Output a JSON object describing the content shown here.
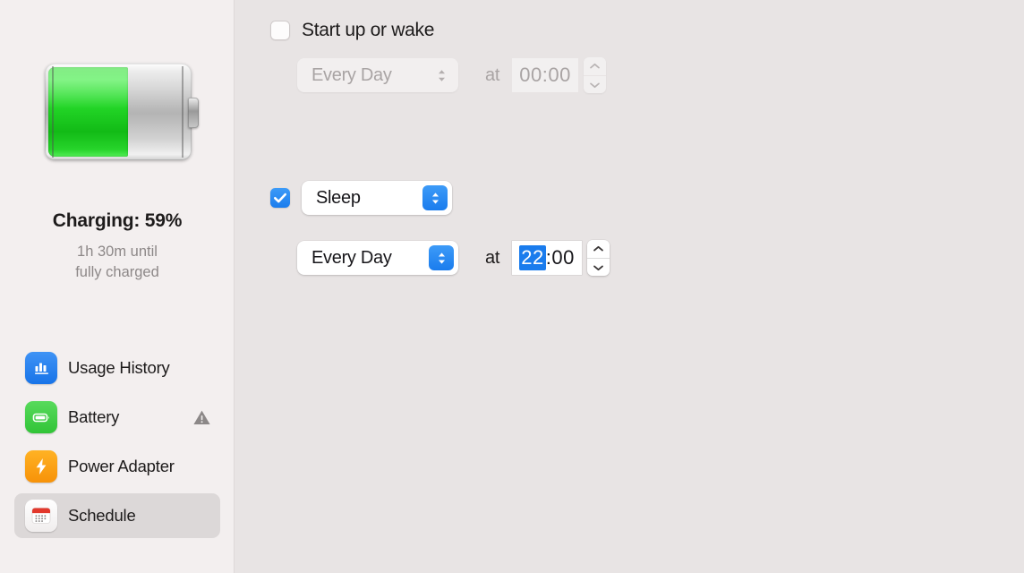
{
  "sidebar": {
    "battery": {
      "level_percent": 59,
      "status": "Charging: 59%",
      "note_line1": "1h 30m until",
      "note_line2": "fully charged"
    },
    "items": [
      {
        "label": "Usage History",
        "icon": "bar-chart-icon",
        "selected": false,
        "warning": false
      },
      {
        "label": "Battery",
        "icon": "battery-icon",
        "selected": false,
        "warning": true
      },
      {
        "label": "Power Adapter",
        "icon": "bolt-icon",
        "selected": false,
        "warning": false
      },
      {
        "label": "Schedule",
        "icon": "calendar-icon",
        "selected": true,
        "warning": false
      }
    ]
  },
  "schedule": {
    "wake": {
      "checkbox_label": "Start up or wake",
      "checked": false,
      "enabled": false,
      "repeat_value": "Every Day",
      "at_label": "at",
      "time_hours": "00",
      "time_separator": ":",
      "time_minutes": "00"
    },
    "sleep": {
      "action_value": "Sleep",
      "checked": true,
      "enabled": true,
      "repeat_value": "Every Day",
      "at_label": "at",
      "time_hours": "22",
      "time_separator": ":",
      "time_minutes": "00"
    }
  },
  "colors": {
    "accent_blue": "#1a7ced",
    "battery_green": "#22d426",
    "sidebar_bg": "#f3efef",
    "content_bg": "#e8e4e4",
    "selected_row_bg": "#dcd8d8"
  }
}
